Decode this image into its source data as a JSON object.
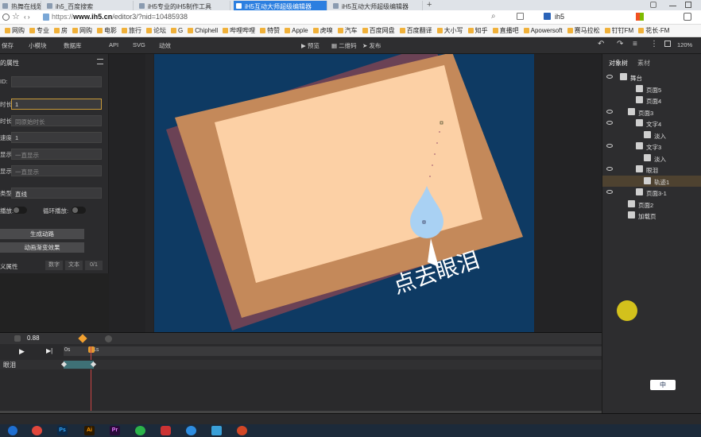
{
  "browser": {
    "tabs": [
      {
        "label": "热舞在线题"
      },
      {
        "label": "ih5_百度搜索"
      },
      {
        "label": "iH5专业的iH5制作工具"
      },
      {
        "label": "iH5互动大师超级编辑器"
      },
      {
        "label": "iH5互动大师超级编辑器"
      }
    ],
    "new_tab": "+",
    "url_prefix": "https://",
    "url_host": "www.ih5.cn",
    "url_path": "/editor3/?nid=10485938",
    "search_text": "ih5"
  },
  "bookmarks": [
    "网购",
    "专业",
    "房",
    "网购",
    "电影",
    "旅行",
    "论坛",
    "G",
    "Chiphell",
    "哔哩哔哩",
    "特赞",
    "Apple",
    "虎嗅",
    "汽车",
    "百度网盘",
    "百度翻译",
    "大小写",
    "知乎",
    "直播吧",
    "Apowersoft",
    "赛马拉松",
    "钉钉FM",
    "花长·FM"
  ],
  "toolbar": {
    "left": [
      "保存",
      "小模块",
      "数据库",
      "API",
      "SVG",
      "动效"
    ],
    "center": [
      "预览",
      "二维码",
      "发布"
    ],
    "zoom": "120%"
  },
  "props": {
    "title": "的属性",
    "rows": [
      {
        "label": "ID:",
        "value": ""
      },
      {
        "label": "时长:",
        "value": "1"
      },
      {
        "label": "时长:",
        "value": "同原始时长"
      },
      {
        "label": "速度:",
        "value": "1"
      },
      {
        "label": "显示:",
        "value": "一直显示"
      },
      {
        "label": "显示:",
        "value": "一直显示"
      }
    ],
    "type_label": "类型:",
    "type_value": "直线",
    "toggle1_label": "播放:",
    "toggle2_label": "循环播放:",
    "btn_gen": "生成动路",
    "btn_effect": "动画渐变效果",
    "custom_label": "义属性",
    "custom_tabs": [
      "数字",
      "文本",
      "0/1"
    ]
  },
  "stage": {
    "caption": "点去眼泪"
  },
  "tree": {
    "tabs": [
      "对象树",
      "素材"
    ],
    "items": [
      {
        "label": "舞台",
        "indent": 0
      },
      {
        "label": "页面5",
        "indent": 2
      },
      {
        "label": "页面4",
        "indent": 2
      },
      {
        "label": "页面3",
        "indent": 1
      },
      {
        "label": "文字4",
        "indent": 2
      },
      {
        "label": "淡入",
        "indent": 3
      },
      {
        "label": "文字3",
        "indent": 2
      },
      {
        "label": "淡入",
        "indent": 3
      },
      {
        "label": "眼泪",
        "indent": 2
      },
      {
        "label": "轨迹1",
        "indent": 3
      },
      {
        "label": "页面3-1",
        "indent": 2
      },
      {
        "label": "页面2",
        "indent": 1
      },
      {
        "label": "加载页",
        "indent": 1
      }
    ],
    "ime": "中"
  },
  "timeline": {
    "time": "0.88",
    "ticks": [
      "0s",
      "1s"
    ],
    "track": "眼泪"
  },
  "taskbar": [
    "Ps",
    "Ai",
    "Pr"
  ],
  "colors": {
    "accent": "#2c7fe0",
    "stage": "#0e3a63",
    "selected": "#4e4230",
    "diamond": "#f0a030"
  }
}
